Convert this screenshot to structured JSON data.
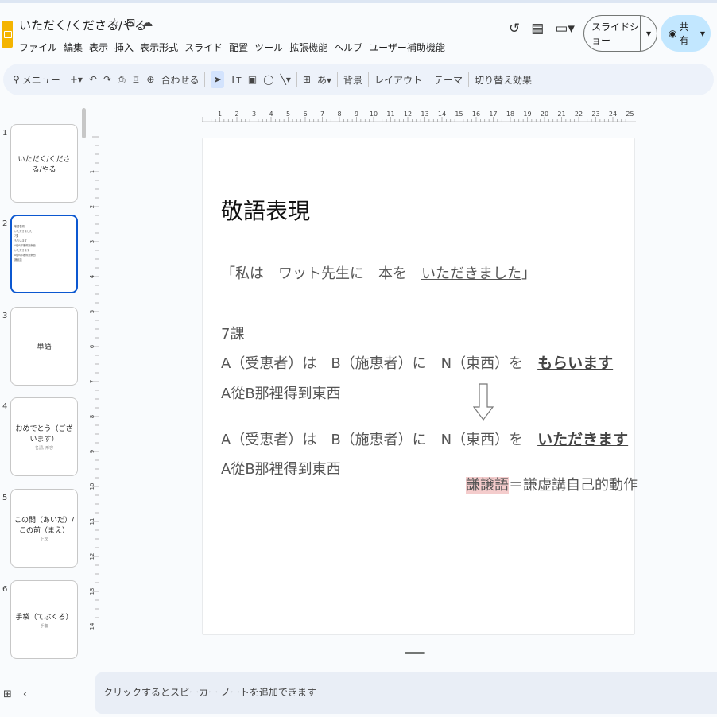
{
  "app": {
    "doc_title": "いただく/くださる/やる",
    "menu": [
      "ファイル",
      "編集",
      "表示",
      "挿入",
      "表示形式",
      "スライド",
      "配置",
      "ツール",
      "拡張機能",
      "ヘルプ",
      "ユーザー補助機能"
    ],
    "slideshow_label": "スライドショー",
    "share_label": "共有"
  },
  "toolbar": {
    "search_label": "メニュー",
    "zoom_label": "合わせる",
    "background_label": "背景",
    "layout_label": "レイアウト",
    "theme_label": "テーマ",
    "transition_label": "切り替え効果"
  },
  "slides": [
    {
      "num": "1",
      "title": "いただく/くださる/やる",
      "sub": ""
    },
    {
      "num": "2",
      "title": "",
      "sub": ""
    },
    {
      "num": "3",
      "title": "単語",
      "sub": ""
    },
    {
      "num": "4",
      "title": "おめでとう（ございます）",
      "sub": "名詞, 形容"
    },
    {
      "num": "5",
      "title": "この間（あいだ）/この前（まえ）",
      "sub": "上次"
    },
    {
      "num": "6",
      "title": "手袋（てぶくろ）",
      "sub": "手套"
    }
  ],
  "ruler": {
    "top": [
      "1",
      "2",
      "3",
      "4",
      "5",
      "6",
      "7",
      "8",
      "9",
      "10",
      "11",
      "12",
      "13",
      "14",
      "15",
      "16",
      "17",
      "18",
      "19",
      "20",
      "21",
      "22",
      "23",
      "24",
      "25"
    ],
    "left": [
      "1",
      "2",
      "3",
      "4",
      "5",
      "6",
      "7",
      "8",
      "9",
      "10",
      "11",
      "12",
      "13",
      "14"
    ]
  },
  "slide": {
    "title": "敬語表現",
    "quote_pre": "「私は　ワット先生に　本を　",
    "quote_u": "いただきました",
    "quote_post": "」",
    "lesson": "7課",
    "line1_pre": "A（受恵者）は　B（施恵者）に　N（東西）を　",
    "line1_verb": "もらいます",
    "line1_tr": "A從B那裡得到東西",
    "line2_pre": "A（受恵者）は　B（施恵者）に　N（東西）を　",
    "line2_verb": "いただきます",
    "line2_tr": "A從B那裡得到東西",
    "note_hl": "謙譲語",
    "note_rest": "＝謙虚講自己的動作"
  },
  "notes_placeholder": "クリックするとスピーカー ノートを追加できます"
}
